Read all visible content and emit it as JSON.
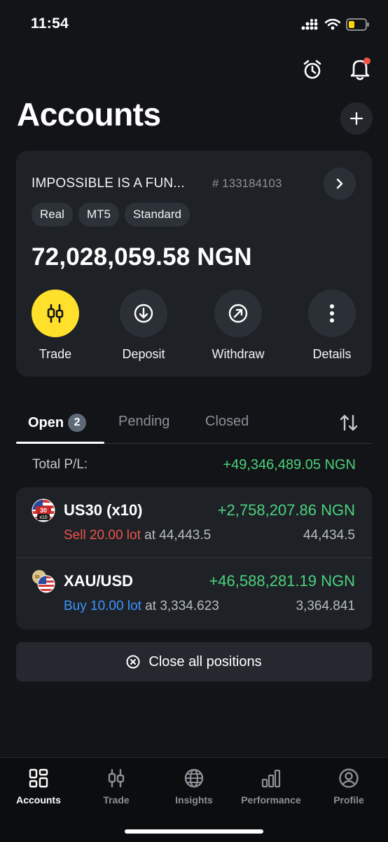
{
  "status_bar": {
    "time": "11:54"
  },
  "header": {
    "title": "Accounts"
  },
  "account": {
    "name": "IMPOSSIBLE IS A FUN...",
    "number": "# 133184103",
    "tags": [
      "Real",
      "MT5",
      "Standard"
    ],
    "balance": "72,028,059.58 NGN",
    "actions": {
      "trade": "Trade",
      "deposit": "Deposit",
      "withdraw": "Withdraw",
      "details": "Details"
    }
  },
  "tabs": {
    "open": "Open",
    "open_count": "2",
    "pending": "Pending",
    "closed": "Closed"
  },
  "total_pl": {
    "label": "Total P/L:",
    "value": "+49,346,489.05 NGN"
  },
  "positions": [
    {
      "symbol": "US30 (x10)",
      "flag_text_top": "30",
      "flag_text_bottom": "x10",
      "profit": "+2,758,207.86 NGN",
      "side": "Sell 20.00 lot",
      "at_text": "at 44,443.5",
      "current": "44,434.5"
    },
    {
      "symbol": "XAU/USD",
      "profit": "+46,588,281.19 NGN",
      "side": "Buy 10.00 lot",
      "at_text": "at 3,334.623",
      "current": "3,364.841"
    }
  ],
  "close_all_label": "Close all positions",
  "bottom_nav": {
    "items": [
      {
        "label": "Accounts",
        "icon": "grid-icon"
      },
      {
        "label": "Trade",
        "icon": "candles-icon"
      },
      {
        "label": "Insights",
        "icon": "globe-icon"
      },
      {
        "label": "Performance",
        "icon": "bar-chart-icon"
      },
      {
        "label": "Profile",
        "icon": "profile-icon"
      }
    ]
  },
  "colors": {
    "accent_yellow": "#ffe02b",
    "profit_green": "#4cd17d",
    "sell_red": "#f0524a",
    "buy_blue": "#3b94ff",
    "notification_red": "#f0524a",
    "battery_low": "#ffd60a"
  }
}
